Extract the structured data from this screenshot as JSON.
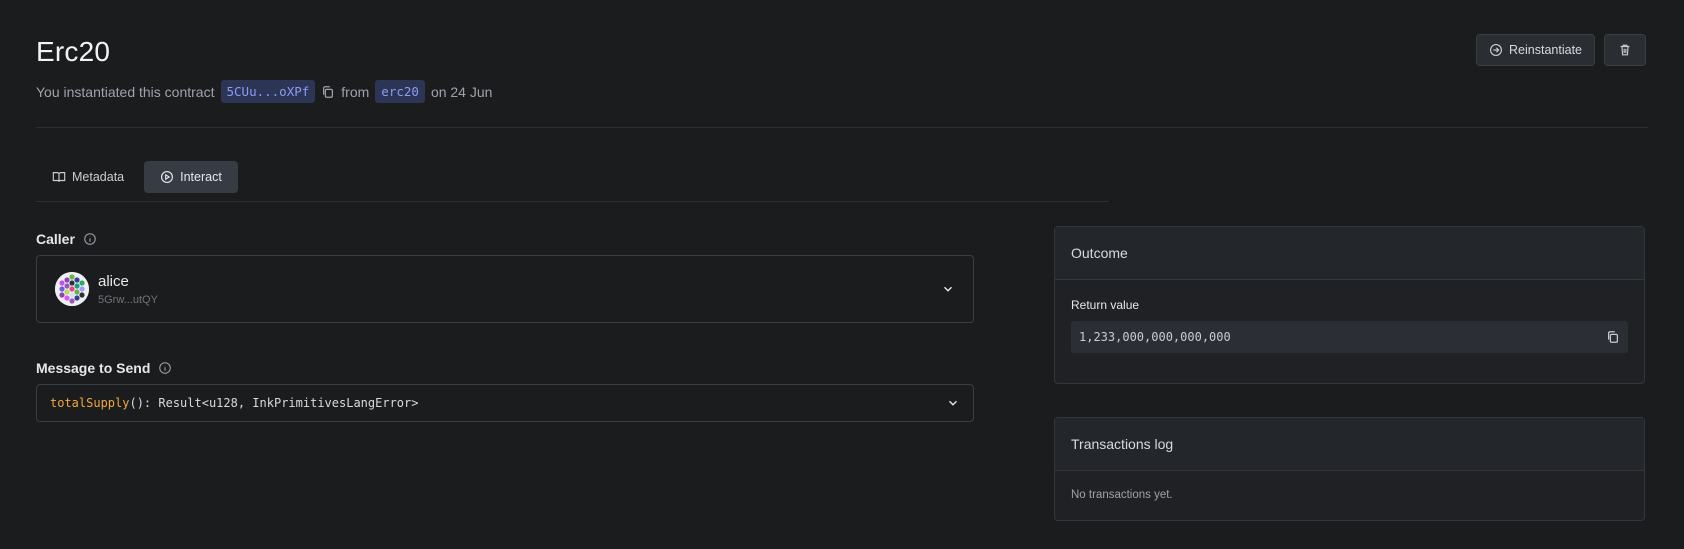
{
  "header": {
    "title": "Erc20",
    "subtitle_prefix": "You instantiated this contract",
    "contract_address": "5CUu...oXPf",
    "from_text": "from",
    "code_name": "erc20",
    "date_text": "on 24 Jun"
  },
  "actions": {
    "reinstantiate_label": "Reinstantiate",
    "delete_icon": "trash-icon"
  },
  "tabs": [
    {
      "label": "Metadata",
      "icon": "book-icon",
      "active": false
    },
    {
      "label": "Interact",
      "icon": "play-circle-icon",
      "active": true
    }
  ],
  "caller": {
    "label": "Caller",
    "name": "alice",
    "address": "5Grw...utQY"
  },
  "message": {
    "label": "Message to Send",
    "fn_name": "totalSupply",
    "signature": "(): Result<u128, InkPrimitivesLangError>"
  },
  "outcome": {
    "title": "Outcome",
    "return_label": "Return value",
    "return_value": "1,233,000,000,000,000"
  },
  "transactions": {
    "title": "Transactions log",
    "empty_text": "No transactions yet."
  },
  "colors": {
    "background": "#1b1c1e",
    "pill_bg": "#2c3556",
    "pill_text": "#8e9bf0",
    "fn_accent": "#f0a83a",
    "active_tab": "#373c44"
  }
}
